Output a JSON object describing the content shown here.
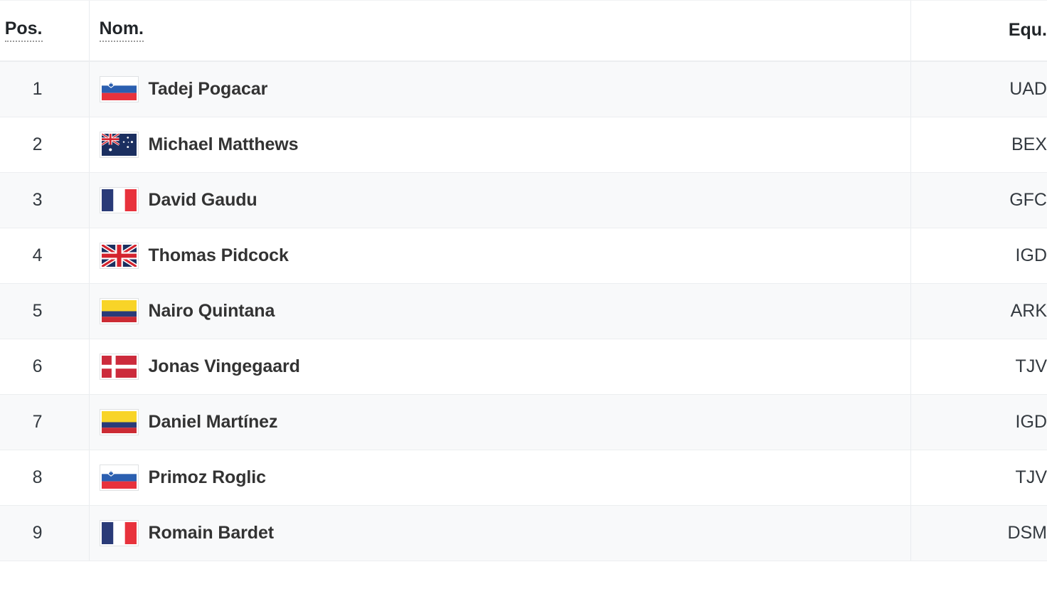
{
  "table": {
    "columns": [
      {
        "key": "pos",
        "label": "Pos.",
        "abbr": true,
        "align": "right"
      },
      {
        "key": "nom",
        "label": "Nom.",
        "abbr": true,
        "align": "left"
      },
      {
        "key": "equ",
        "label": "Equ.",
        "abbr": false,
        "align": "right"
      }
    ],
    "rows": [
      {
        "pos": "1",
        "flag": "flag-slovenia",
        "name": "Tadej Pogacar",
        "team": "UAD"
      },
      {
        "pos": "2",
        "flag": "flag-australia",
        "name": "Michael Matthews",
        "team": "BEX"
      },
      {
        "pos": "3",
        "flag": "flag-france",
        "name": "David Gaudu",
        "team": "GFC"
      },
      {
        "pos": "4",
        "flag": "flag-uk",
        "name": "Thomas Pidcock",
        "team": "IGD"
      },
      {
        "pos": "5",
        "flag": "flag-colombia",
        "name": "Nairo Quintana",
        "team": "ARK"
      },
      {
        "pos": "6",
        "flag": "flag-denmark",
        "name": "Jonas Vingegaard",
        "team": "TJV"
      },
      {
        "pos": "7",
        "flag": "flag-colombia",
        "name": "Daniel Martínez",
        "team": "IGD"
      },
      {
        "pos": "8",
        "flag": "flag-slovenia",
        "name": "Primoz Roglic",
        "team": "TJV"
      },
      {
        "pos": "9",
        "flag": "flag-france",
        "name": "Romain Bardet",
        "team": "DSM"
      }
    ]
  },
  "colors": {
    "row_stripe": "#f8f9fa",
    "row_base": "#ffffff",
    "border": "#eceef0",
    "header_text": "#212529",
    "name_text": "#333333",
    "value_text": "#343a40"
  }
}
